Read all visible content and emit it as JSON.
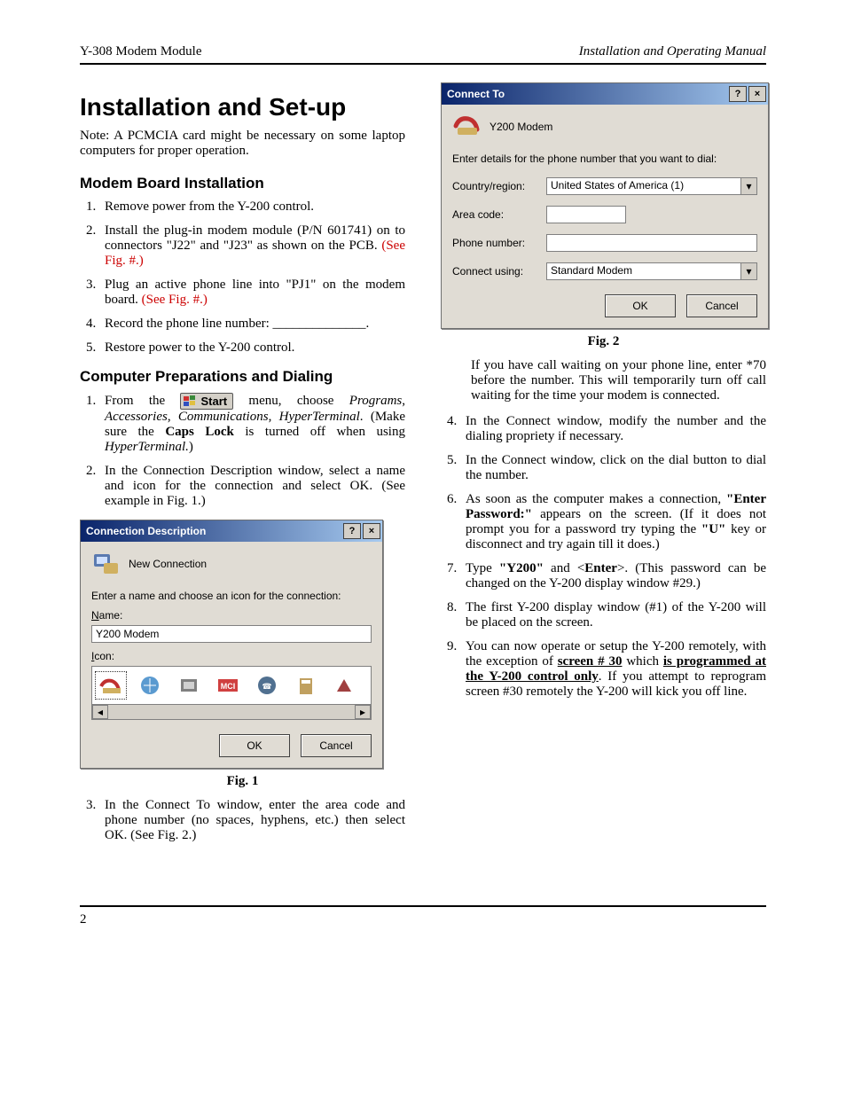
{
  "header": {
    "left": "Y-308 Modem Module",
    "right": "Installation and Operating Manual"
  },
  "h1": "Installation and Set-up",
  "note": "Note: A PCMCIA card might be necessary on some laptop computers for proper operation.",
  "sec1_title": "Modem Board Installation",
  "sec1_items": {
    "s1": "Remove power from the Y-200 control.",
    "s2a": "Install the plug-in modem module (P/N 601741) on to connectors \"J22\" and \"J23\" as shown on the PCB. ",
    "s2b": "(See Fig. #.)",
    "s3a": "Plug an active phone line into \"PJ1\" on the modem board. ",
    "s3b": "(See Fig. #.)",
    "s4": "Record the phone line number: ______________.",
    "s5": "Restore power to the Y-200 control."
  },
  "sec2_title": "Computer Preparations and Dialing",
  "sec2": {
    "s1_pre": "From the ",
    "s1_start": "Start",
    "s1_post": " menu, choose Programs, Accessories, Communications, HyperTerminal. (Make sure the Caps Lock is turned off when using HyperTerminal.)",
    "s2": "In the Connection Description window, select a name and icon for the connection and select OK. (See example in Fig. 1.)",
    "s3": "In the Connect To window, enter the area code and phone number (no spaces, hyphens, etc.) then select OK. (See Fig. 2.)"
  },
  "fig1_caption": "Fig. 1",
  "fig1": {
    "title": "Connection Description",
    "subtitle": "New Connection",
    "prompt": "Enter a name and choose an icon for the connection:",
    "name_label": "Name:",
    "name_value": "Y200 Modem",
    "icon_label": "Icon:",
    "ok": "OK",
    "cancel": "Cancel"
  },
  "fig2_caption": "Fig. 2",
  "fig2": {
    "title": "Connect To",
    "subtitle": "Y200 Modem",
    "prompt": "Enter details for the phone number that you want to dial:",
    "country_label": "Country/region:",
    "country_value": "United States of America (1)",
    "area_label": "Area code:",
    "area_value": "",
    "phone_label": "Phone number:",
    "phone_value": "",
    "connect_label": "Connect using:",
    "connect_value": "Standard Modem",
    "ok": "OK",
    "cancel": "Cancel"
  },
  "right_text": {
    "callwait": "If you have call waiting on your phone line, enter *70 before the number. This will temporarily turn off call waiting for the time your modem is connected.",
    "s4": "In the Connect window, modify the number and the dialing propriety if necessary.",
    "s5": "In the Connect window, click on the dial button to dial the number.",
    "s6a": "As soon as the computer makes a connection, ",
    "s6b": "\"Enter Password:\"",
    "s6c": " appears on the screen. (If it does not prompt you for a password try typing the ",
    "s6d": "\"U\"",
    "s6e": " key or disconnect and try again till it does.)",
    "s7a": "Type ",
    "s7b": "\"Y200\"",
    "s7c": " and <",
    "s7d": "Enter",
    "s7e": ">. (This password can be changed on the Y-200 display window #29.)",
    "s8": "The first Y-200 display window (#1) of the Y-200 will be placed on the screen.",
    "s9a": "You can now operate or setup the Y-200 remotely, with the exception of ",
    "s9b": "screen # 30",
    "s9c": " which ",
    "s9d": "is programmed at the Y-200 control only",
    "s9e": ". If you attempt to reprogram screen #30 remotely the Y-200 will kick you off line."
  },
  "page_number": "2"
}
